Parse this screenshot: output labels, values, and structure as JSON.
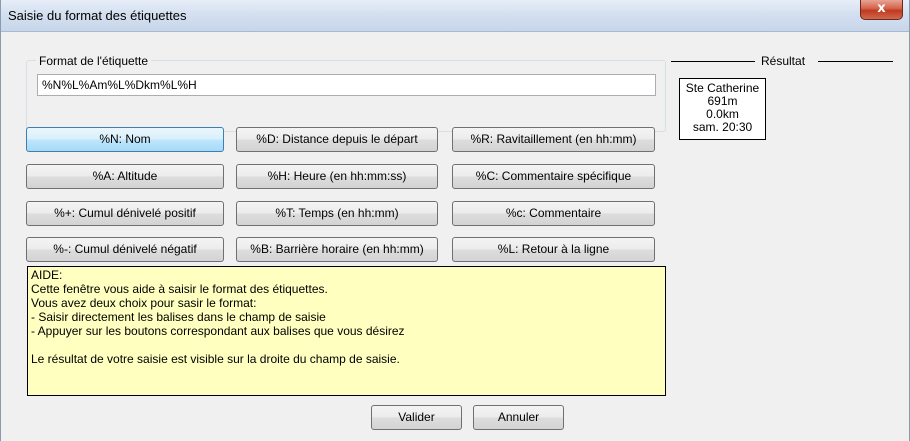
{
  "window": {
    "title": "Saisie du format des étiquettes",
    "close_glyph": "x"
  },
  "format": {
    "group_label": "Format de l'étiquette",
    "value": "%N%L%Am%L%Dkm%L%H"
  },
  "result": {
    "label": "Résultat",
    "lines": [
      "Ste Catherine",
      "691m",
      "0.0km",
      "sam. 20:30"
    ]
  },
  "buttons": {
    "nom": "%N: Nom",
    "distance": "%D: Distance depuis le départ",
    "ravitaillement": "%R: Ravitaillement (en hh:mm)",
    "altitude": "%A: Altitude",
    "heure": "%H: Heure (en hh:mm:ss)",
    "commentaire_specifique": "%C: Commentaire spécifique",
    "cumul_positif": "%+: Cumul dénivelé positif",
    "temps": "%T: Temps (en hh:mm)",
    "commentaire": "%c: Commentaire",
    "cumul_negatif": "%-: Cumul dénivelé négatif",
    "barriere": "%B: Barrière horaire (en hh:mm)",
    "retour": "%L: Retour à la ligne"
  },
  "help": {
    "lines": [
      "AIDE:",
      "Cette fenêtre vous aide à saisir le format des étiquettes.",
      "Vous avez deux choix pour sasir le format:",
      "- Saisir directement les balises dans le champ de saisie",
      "- Appuyer sur les boutons correspondant aux balises que vous désirez",
      "",
      "Le résultat de votre saisie est visible sur la droite du champ de saisie."
    ]
  },
  "actions": {
    "valider": "Valider",
    "annuler": "Annuler"
  },
  "colors": {
    "help_background": "#ffffc0",
    "close_button": "#c7442b",
    "focused_button_border": "#3c7fb1"
  }
}
